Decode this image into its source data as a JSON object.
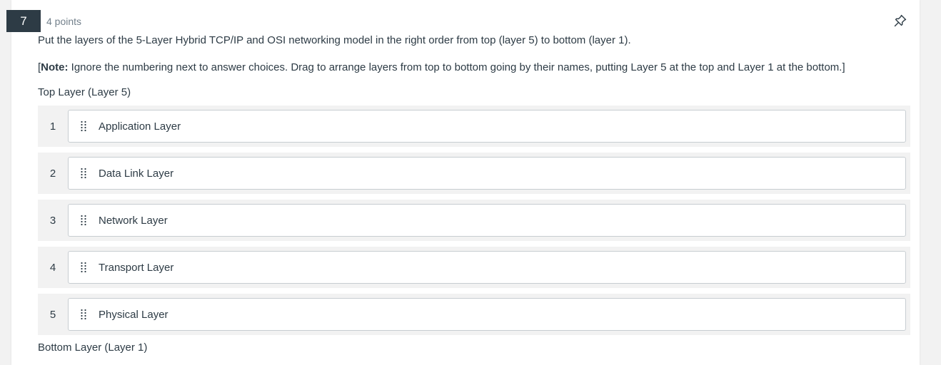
{
  "question": {
    "number": "7",
    "points": "4 points",
    "prompt": "Put the layers of the 5-Layer Hybrid TCP/IP and OSI networking model in the right order from top (layer 5) to bottom (layer 1).",
    "note_open": "[",
    "note_label": "Note:",
    "note_text": " Ignore the numbering next to answer choices. Drag to arrange layers from top to bottom going by their names, putting Layer 5 at the top and Layer 1 at the bottom.]",
    "top_label": "Top Layer (Layer 5)",
    "bottom_label": "Bottom Layer (Layer 1)"
  },
  "items": [
    {
      "num": "1",
      "label": "Application Layer"
    },
    {
      "num": "2",
      "label": "Data Link Layer"
    },
    {
      "num": "3",
      "label": "Network Layer"
    },
    {
      "num": "4",
      "label": "Transport Layer"
    },
    {
      "num": "5",
      "label": "Physical Layer"
    }
  ],
  "icons": {
    "pin": "pin-icon",
    "drag": "drag-handle-icon"
  },
  "colors": {
    "badge_bg": "#2d3b45",
    "text": "#2d3b45",
    "muted": "#73818c",
    "row_bg": "#f2f2f2",
    "item_border": "#c7cdd1"
  }
}
